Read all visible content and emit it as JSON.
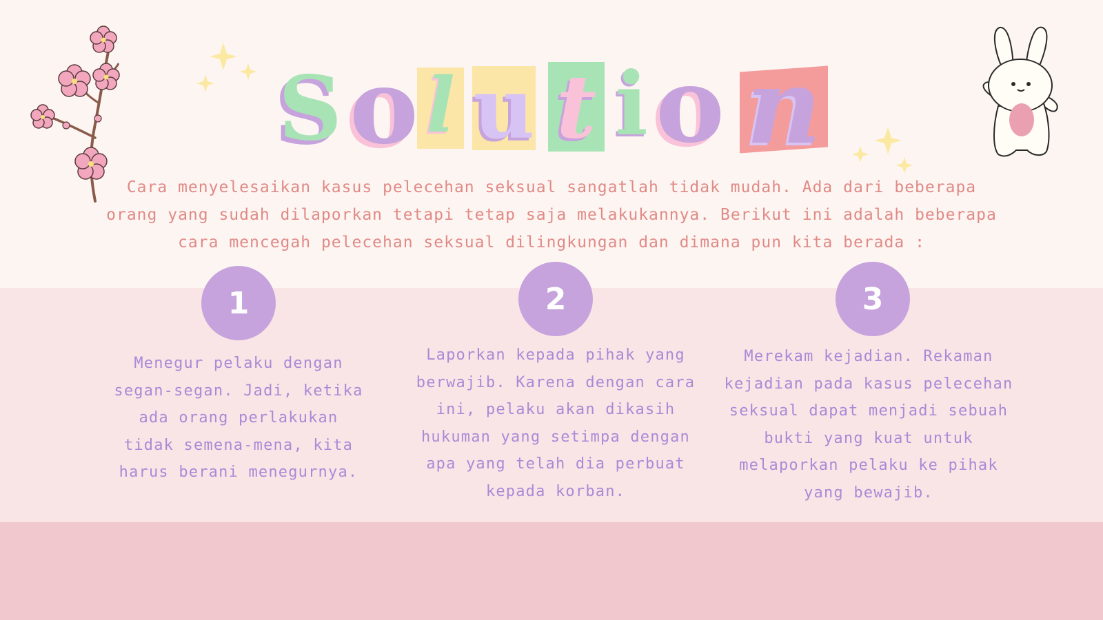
{
  "title": {
    "letters": [
      "S",
      "o",
      "l",
      "u",
      "t",
      "i",
      "o",
      "n"
    ]
  },
  "intro": {
    "text": "Cara menyelesaikan kasus pelecehan seksual sangatlah tidak mudah. Ada dari beberapa orang yang sudah dilaporkan tetapi tetap saja melakukannya. Berikut ini adalah beberapa cara mencegah pelecehan seksual dilingkungan dan dimana pun kita berada :"
  },
  "steps": [
    {
      "number": "1",
      "text": "Menegur pelaku dengan segan-segan. Jadi, ketika ada orang perlakukan tidak semena-mena, kita harus berani menegurnya."
    },
    {
      "number": "2",
      "text": "Laporkan kepada pihak yang berwajib. Karena dengan cara ini, pelaku akan dikasih hukuman yang setimpa dengan apa yang telah dia perbuat kepada korban."
    },
    {
      "number": "3",
      "text": "Merekam kejadian. Rekaman kejadian pada kasus pelecehan seksual dapat menjadi sebuah bukti yang kuat untuk melaporkan pelaku ke pihak yang bewajib."
    }
  ],
  "colors": {
    "background": "#fdf5f2",
    "band_mid": "#f9e5e6",
    "band_bottom": "#f0c8cd",
    "intro_text": "#e08a86",
    "step_text": "#a98ad6",
    "circle": "#c6a3dc"
  },
  "icons": [
    "sparkle-icon",
    "cherry-blossom-branch-icon",
    "bunny-icon"
  ]
}
